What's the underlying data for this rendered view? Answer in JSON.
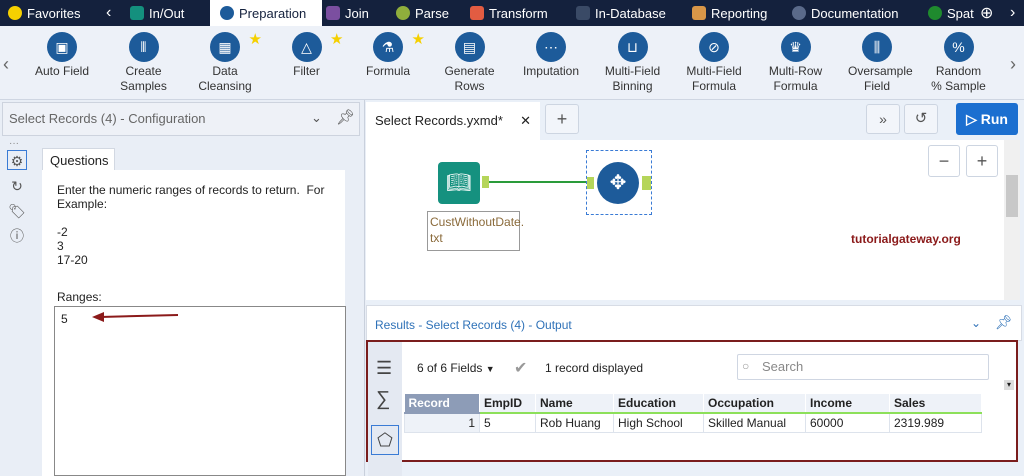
{
  "categories": [
    {
      "label": "Favorites",
      "color": "#f5d000"
    },
    {
      "label": "In/Out",
      "color": "#14907e"
    },
    {
      "label": "Preparation",
      "color": "#1d5b9a",
      "active": true
    },
    {
      "label": "Join",
      "color": "#7b4fa0"
    },
    {
      "label": "Parse",
      "color": "#8fae3c"
    },
    {
      "label": "Transform",
      "color": "#e25c42"
    },
    {
      "label": "In-Database",
      "color": "#3a4a66"
    },
    {
      "label": "Reporting",
      "color": "#d89648"
    },
    {
      "label": "Documentation",
      "color": "#5a6a8a"
    },
    {
      "label": "Spat",
      "color": "#1f8a2e"
    }
  ],
  "tools": [
    {
      "label": "Auto Field",
      "star": false
    },
    {
      "label": "Create Samples",
      "star": false
    },
    {
      "label": "Data Cleansing",
      "star": true
    },
    {
      "label": "Filter",
      "star": true
    },
    {
      "label": "Formula",
      "star": true
    },
    {
      "label": "Generate Rows",
      "star": false
    },
    {
      "label": "Imputation",
      "star": false
    },
    {
      "label": "Multi-Field Binning",
      "star": false
    },
    {
      "label": "Multi-Field Formula",
      "star": false
    },
    {
      "label": "Multi-Row Formula",
      "star": false
    },
    {
      "label": "Oversample Field",
      "star": false
    },
    {
      "label": "Random % Sample",
      "star": false
    }
  ],
  "config": {
    "title": "Select Records (4) - Configuration",
    "tab": "Questions",
    "instructions": "Enter the numeric ranges of records to return.  For\nExample:\n\n-2\n3\n17-20",
    "ranges_label": "Ranges:",
    "ranges_value": "5"
  },
  "canvas": {
    "doc_tab": "Select Records.yxmd*",
    "close": "✕",
    "run_label": "Run",
    "input_node_label": "CustWithoutDate.\ntxt",
    "watermark": "tutorialgateway.org"
  },
  "results": {
    "title": "Results - Select Records (4) - Output",
    "fields": "6 of 6 Fields",
    "status": "1 record displayed",
    "search_placeholder": "Search",
    "columns": [
      "Record",
      "EmpID",
      "Name",
      "Education",
      "Occupation",
      "Income",
      "Sales"
    ],
    "rows": [
      [
        "1",
        "5",
        "Rob Huang",
        "High School",
        "Skilled Manual",
        "60000",
        "2319.989"
      ]
    ]
  }
}
